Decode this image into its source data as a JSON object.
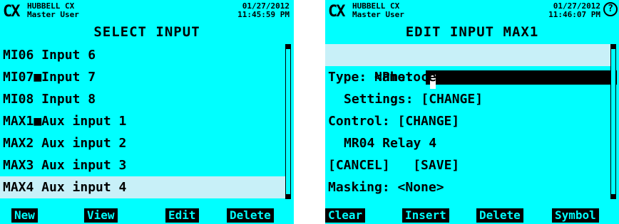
{
  "left": {
    "org": "HUBBELL CX",
    "user": "Master User",
    "date": "01/27/2012",
    "time": "11:45:59 PM",
    "title": "SELECT INPUT",
    "items": [
      "MI06 Input 6",
      "MI07■Input 7",
      "MI08 Input 8",
      "MAX1■Aux input 1",
      "MAX2 Aux input 2",
      "MAX3 Aux input 3",
      "MAX4 Aux input 4"
    ],
    "selected_index": 6,
    "softkeys": [
      "New",
      "View",
      "Edit",
      "Delete"
    ]
  },
  "right": {
    "org": "HUBBELL CX",
    "user": "Master User",
    "date": "01/27/2012",
    "time": "11:46:07 PM",
    "help_icon": "help-icon",
    "title": "EDIT INPUT MAX1",
    "name_label": "Name:",
    "type_line": "Type: <Photocell>",
    "settings_line": "Settings: [CHANGE]",
    "control_line": "Control: [CHANGE]",
    "relay_line": "MR04 Relay 4",
    "cancel": "[CANCEL]",
    "save": "[SAVE]",
    "masking_line": "Masking: <None>",
    "softkeys": [
      "Clear",
      "Insert",
      "Delete",
      "Symbol"
    ]
  },
  "colors": {
    "screen": "#00ffff",
    "highlight": "#c8f0f8",
    "text": "#000000"
  }
}
